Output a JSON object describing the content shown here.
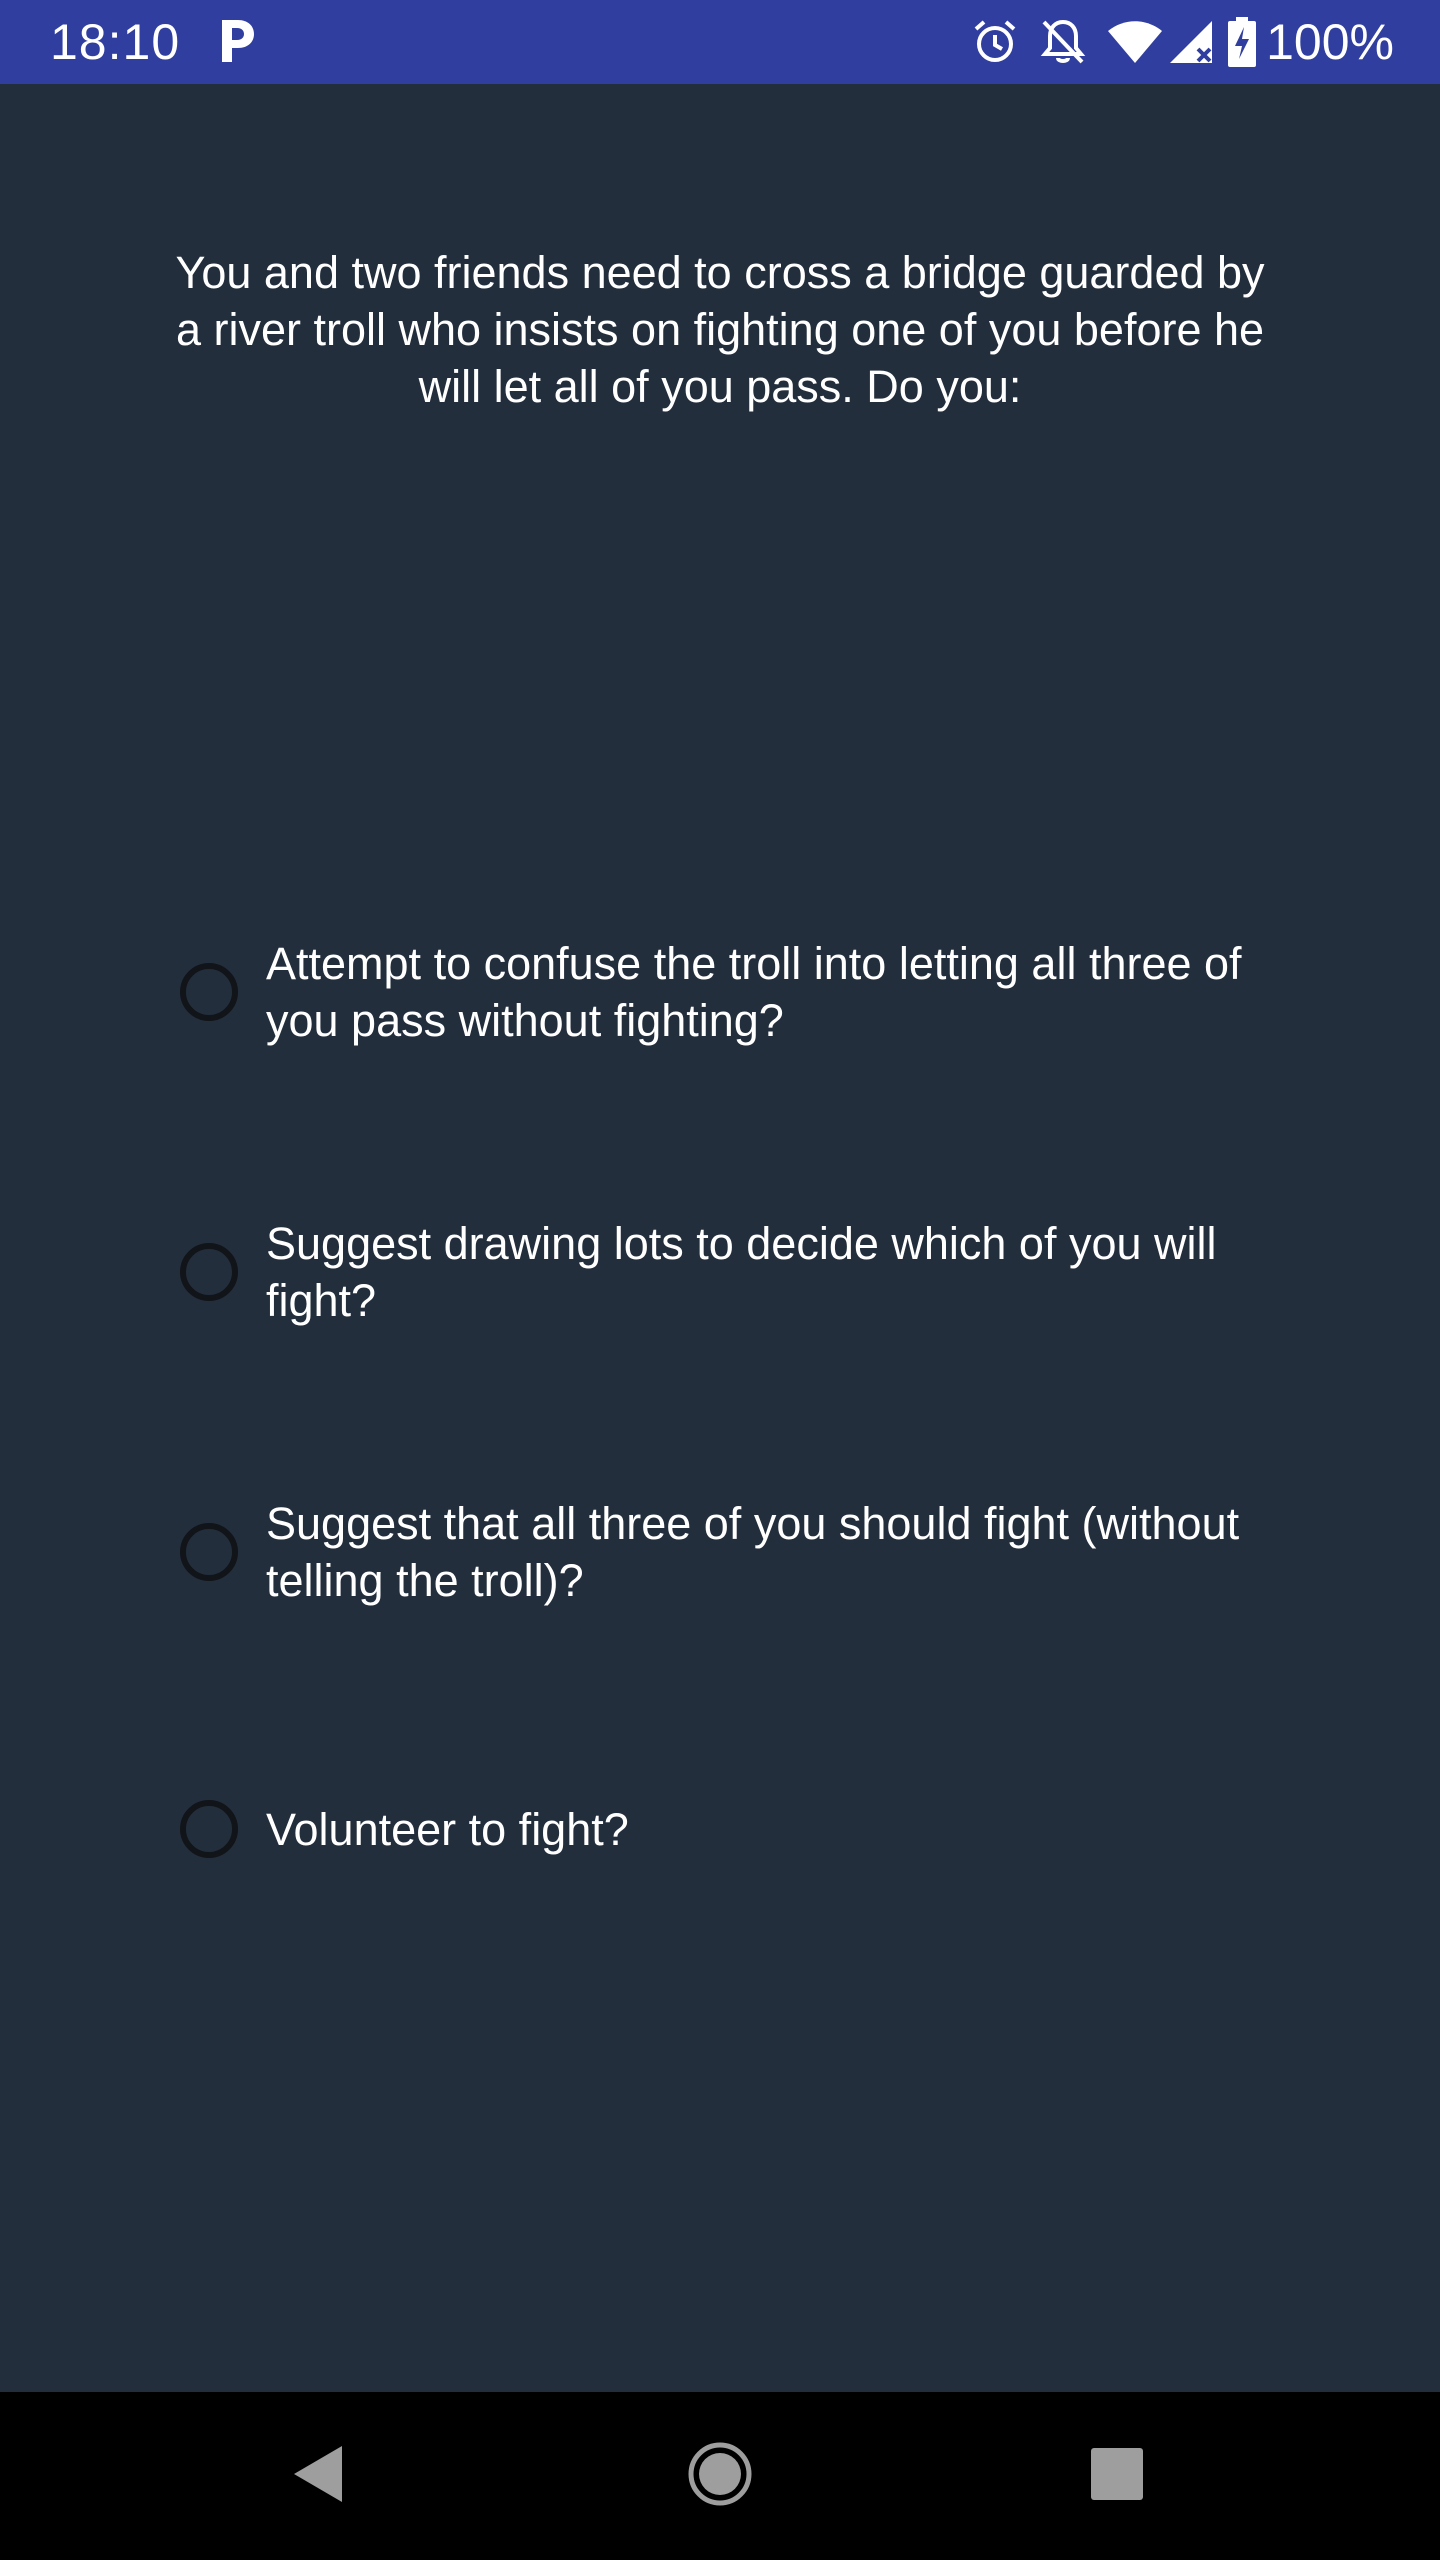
{
  "status_bar": {
    "time": "18:10",
    "battery": "100%",
    "background": "#303f9f",
    "icons": [
      "parking-icon",
      "alarm-icon",
      "notifications-off-icon",
      "wifi-icon",
      "cell-signal-icon",
      "battery-charging-icon"
    ]
  },
  "quiz": {
    "question": "You and two friends need to cross a bridge guarded by a river troll who insists on fighting one of you before he will let all of you pass. Do you:",
    "options": [
      {
        "label": "Attempt to confuse the troll into letting all three of you pass without fighting?",
        "selected": false
      },
      {
        "label": "Suggest drawing lots to decide which of you will fight?",
        "selected": false
      },
      {
        "label": "Suggest that all three of you should fight (without telling the troll)?",
        "selected": false
      },
      {
        "label": "Volunteer to fight?",
        "selected": false
      }
    ]
  },
  "nav_bar": {
    "icons": [
      "back-icon",
      "home-icon",
      "recents-icon"
    ]
  },
  "colors": {
    "background": "#232e3d",
    "text": "#ffffff",
    "radio": "#111418"
  }
}
